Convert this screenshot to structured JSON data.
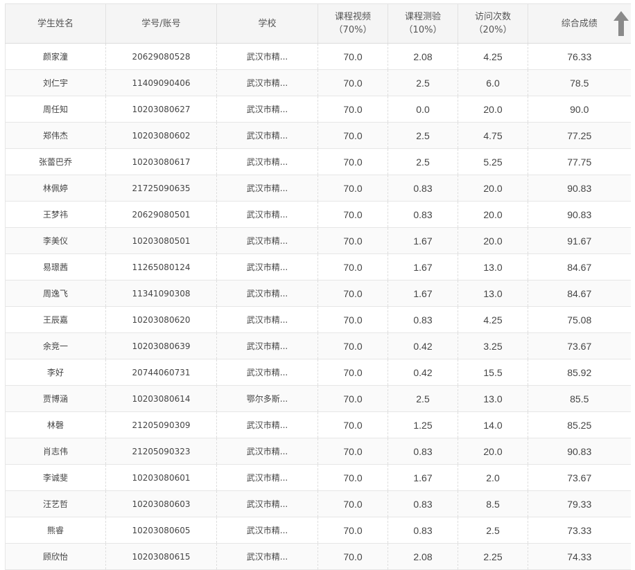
{
  "headers": {
    "name": "学生姓名",
    "account": "学号/账号",
    "school": "学校",
    "video": "课程视频",
    "video_pct": "（70%）",
    "quiz": "课程测验",
    "quiz_pct": "（10%）",
    "visits": "访问次数",
    "visits_pct": "（20%）",
    "total": "综合成绩"
  },
  "icons": {
    "scroll_up": "up-arrow-icon"
  },
  "rows": [
    {
      "name": "颜家潼",
      "account": "20629080528",
      "school": "武汉市精...",
      "video": "70.0",
      "quiz": "2.08",
      "visits": "4.25",
      "total": "76.33"
    },
    {
      "name": "刘仁宇",
      "account": "11409090406",
      "school": "武汉市精...",
      "video": "70.0",
      "quiz": "2.5",
      "visits": "6.0",
      "total": "78.5"
    },
    {
      "name": "周任知",
      "account": "10203080627",
      "school": "武汉市精...",
      "video": "70.0",
      "quiz": "0.0",
      "visits": "20.0",
      "total": "90.0"
    },
    {
      "name": "郑伟杰",
      "account": "10203080602",
      "school": "武汉市精...",
      "video": "70.0",
      "quiz": "2.5",
      "visits": "4.75",
      "total": "77.25"
    },
    {
      "name": "张蕾巴乔",
      "account": "10203080617",
      "school": "武汉市精...",
      "video": "70.0",
      "quiz": "2.5",
      "visits": "5.25",
      "total": "77.75"
    },
    {
      "name": "林佩婷",
      "account": "21725090635",
      "school": "武汉市精...",
      "video": "70.0",
      "quiz": "0.83",
      "visits": "20.0",
      "total": "90.83"
    },
    {
      "name": "王梦祎",
      "account": "20629080501",
      "school": "武汉市精...",
      "video": "70.0",
      "quiz": "0.83",
      "visits": "20.0",
      "total": "90.83"
    },
    {
      "name": "李美仪",
      "account": "10203080501",
      "school": "武汉市精...",
      "video": "70.0",
      "quiz": "1.67",
      "visits": "20.0",
      "total": "91.67"
    },
    {
      "name": "易璟茜",
      "account": "11265080124",
      "school": "武汉市精...",
      "video": "70.0",
      "quiz": "1.67",
      "visits": "13.0",
      "total": "84.67"
    },
    {
      "name": "周逸飞",
      "account": "11341090308",
      "school": "武汉市精...",
      "video": "70.0",
      "quiz": "1.67",
      "visits": "13.0",
      "total": "84.67"
    },
    {
      "name": "王辰嘉",
      "account": "10203080620",
      "school": "武汉市精...",
      "video": "70.0",
      "quiz": "0.83",
      "visits": "4.25",
      "total": "75.08"
    },
    {
      "name": "余竞一",
      "account": "10203080639",
      "school": "武汉市精...",
      "video": "70.0",
      "quiz": "0.42",
      "visits": "3.25",
      "total": "73.67"
    },
    {
      "name": "李好",
      "account": "20744060731",
      "school": "武汉市精...",
      "video": "70.0",
      "quiz": "0.42",
      "visits": "15.5",
      "total": "85.92"
    },
    {
      "name": "贾博涵",
      "account": "10203080614",
      "school": "鄂尔多斯...",
      "video": "70.0",
      "quiz": "2.5",
      "visits": "13.0",
      "total": "85.5"
    },
    {
      "name": "林磬",
      "account": "21205090309",
      "school": "武汉市精...",
      "video": "70.0",
      "quiz": "1.25",
      "visits": "14.0",
      "total": "85.25"
    },
    {
      "name": "肖志伟",
      "account": "21205090323",
      "school": "武汉市精...",
      "video": "70.0",
      "quiz": "0.83",
      "visits": "20.0",
      "total": "90.83"
    },
    {
      "name": "李诚斐",
      "account": "10203080601",
      "school": "武汉市精...",
      "video": "70.0",
      "quiz": "1.67",
      "visits": "2.0",
      "total": "73.67"
    },
    {
      "name": "汪艺哲",
      "account": "10203080603",
      "school": "武汉市精...",
      "video": "70.0",
      "quiz": "0.83",
      "visits": "8.5",
      "total": "79.33"
    },
    {
      "name": "熊睿",
      "account": "10203080605",
      "school": "武汉市精...",
      "video": "70.0",
      "quiz": "0.83",
      "visits": "2.5",
      "total": "73.33"
    },
    {
      "name": "顾欣怡",
      "account": "10203080615",
      "school": "武汉市精...",
      "video": "70.0",
      "quiz": "2.08",
      "visits": "2.25",
      "total": "74.33"
    }
  ]
}
